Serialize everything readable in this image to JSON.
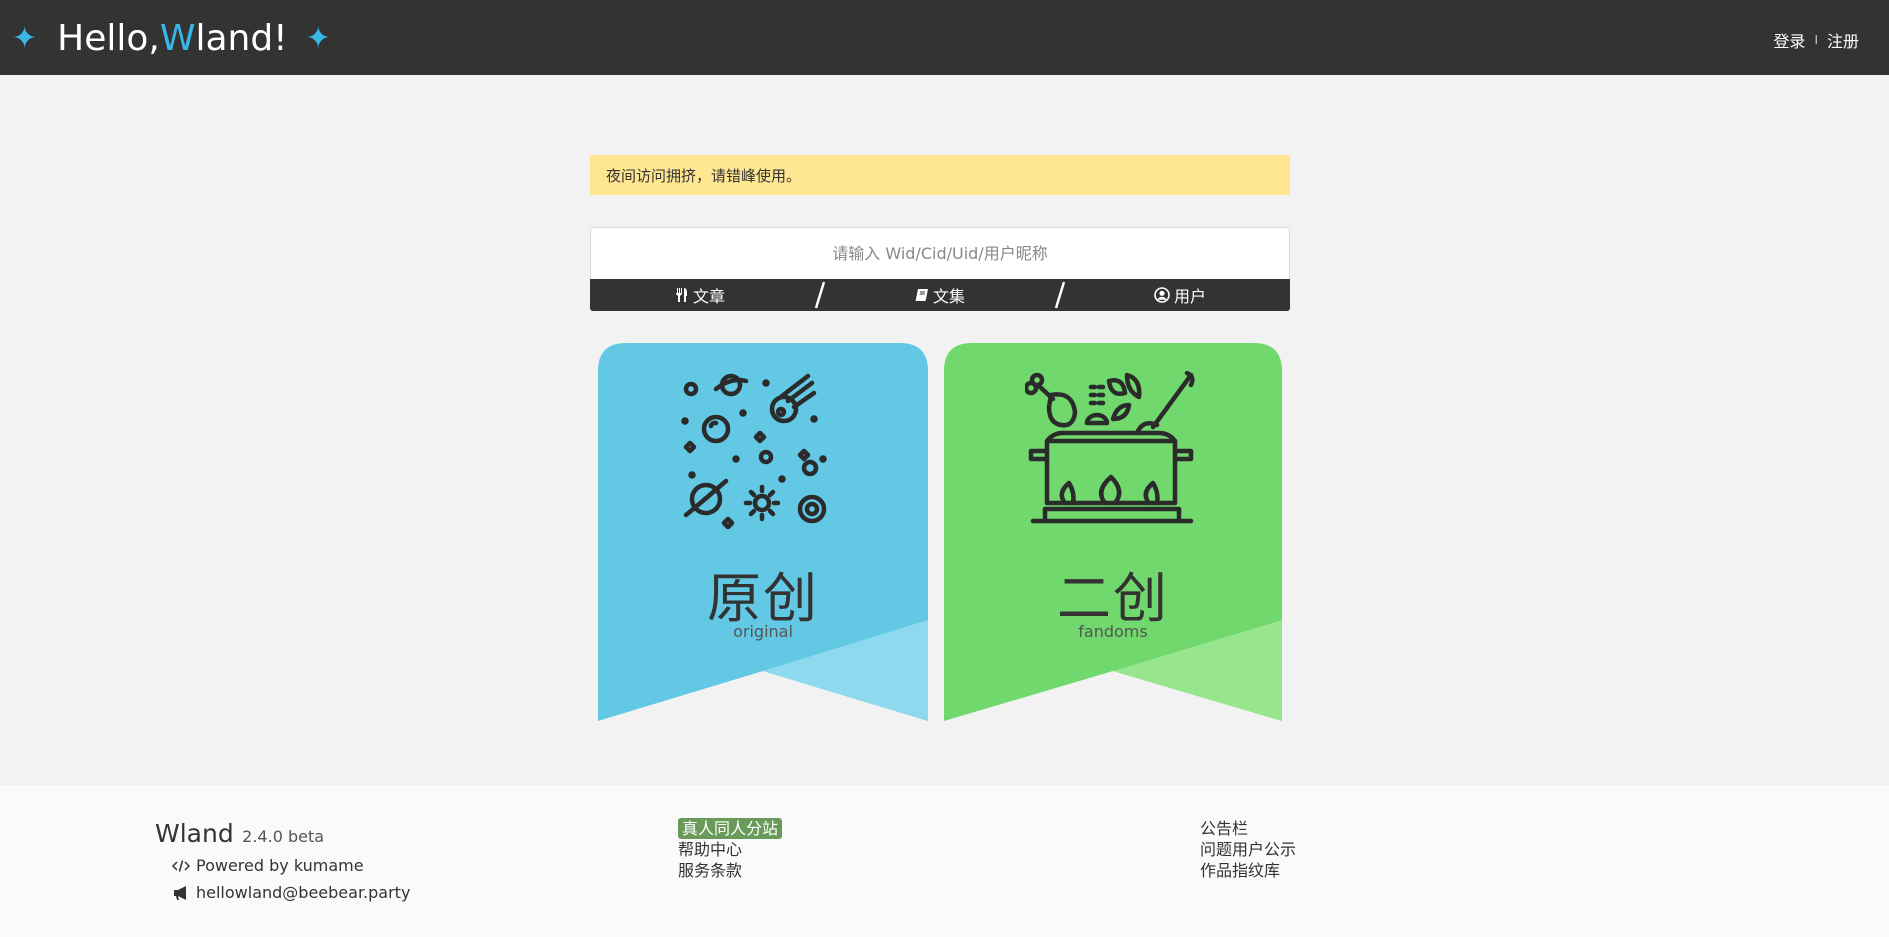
{
  "header": {
    "brand_hello": "Hello, ",
    "brand_w": "W",
    "brand_rest": "land!",
    "login": "登录",
    "separator": "I",
    "register": "注册",
    "accent": "#38b6e8"
  },
  "notice": {
    "text": "夜间访问拥挤，请错峰使用。",
    "bg": "#ffe690"
  },
  "search": {
    "placeholder": "请输入 Wid/Cid/Uid/用户昵称",
    "value": "",
    "tabs": [
      {
        "label": "文章",
        "icon": "utensils-icon"
      },
      {
        "label": "文集",
        "icon": "book-icon"
      },
      {
        "label": "用户",
        "icon": "user-circle-icon"
      }
    ]
  },
  "cards": {
    "original": {
      "title": "原创",
      "subtitle": "original",
      "color": "#62c8e4",
      "color_light": "#8ddaee",
      "icon": "space-planets-icon"
    },
    "fandoms": {
      "title": "二创",
      "subtitle": "fandoms",
      "color": "#70d86c",
      "color_light": "#97e68e",
      "icon": "cooking-pot-icon"
    }
  },
  "footer": {
    "site_name": "Wland",
    "version": "2.4.0 beta",
    "powered": "Powered by kumame",
    "email": "hellowland@beebear.party",
    "col2": [
      "真人同人分站",
      "帮助中心",
      "服务条款"
    ],
    "col3": [
      "公告栏",
      "问题用户公示",
      "作品指纹库"
    ],
    "badge_color": "#6a9a5a"
  }
}
